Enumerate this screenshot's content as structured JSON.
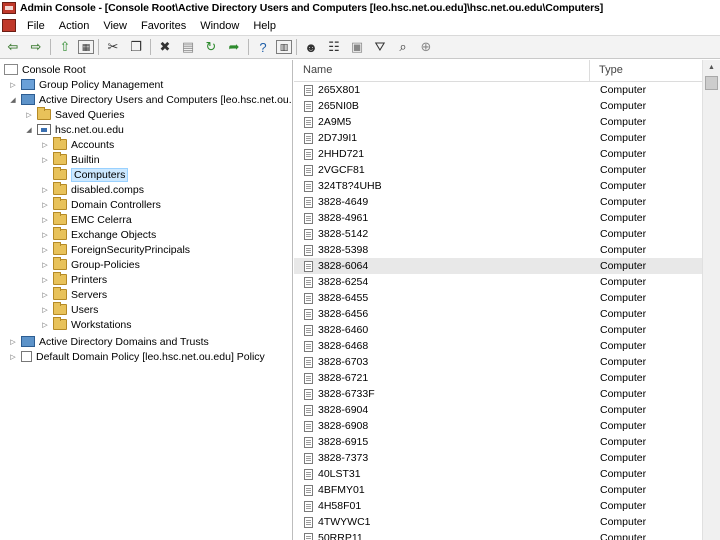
{
  "window": {
    "title": "Admin Console - [Console Root\\Active Directory Users and Computers [leo.hsc.net.ou.edu]\\hsc.net.ou.edu\\Computers]"
  },
  "menu": {
    "items": [
      "File",
      "Action",
      "View",
      "Favorites",
      "Window",
      "Help"
    ]
  },
  "toolbar": {
    "icons": [
      "back-arrow-icon",
      "forward-arrow-icon",
      "up-folder-icon",
      "show-tree-icon",
      "cut-icon",
      "copy-icon",
      "delete-icon",
      "properties-icon",
      "refresh-icon",
      "export-list-icon",
      "help-icon",
      "console-tree-icon",
      "new-user-icon",
      "new-group-icon",
      "new-ou-icon",
      "filter-icon",
      "find-icon",
      "add-to-group-icon"
    ]
  },
  "tree": {
    "items": [
      {
        "label": "Console Root",
        "depth": 0,
        "icon": "console-icon",
        "expander": ""
      },
      {
        "label": "Group Policy Management",
        "depth": 1,
        "icon": "group-policy-icon",
        "expander": "collapsed"
      },
      {
        "label": "Active Directory Users and Computers [leo.hsc.net.ou.edu]",
        "depth": 1,
        "icon": "ad-users-icon",
        "expander": "expanded"
      },
      {
        "label": "Saved Queries",
        "depth": 2,
        "icon": "folder-icon",
        "expander": "collapsed"
      },
      {
        "label": "hsc.net.ou.edu",
        "depth": 2,
        "icon": "domain-icon",
        "expander": "expanded"
      },
      {
        "label": "Accounts",
        "depth": 3,
        "icon": "folder-icon",
        "expander": "collapsed"
      },
      {
        "label": "Builtin",
        "depth": 3,
        "icon": "folder-icon",
        "expander": "collapsed"
      },
      {
        "label": "Computers",
        "depth": 3,
        "icon": "folder-icon",
        "expander": "",
        "selected": true
      },
      {
        "label": "disabled.comps",
        "depth": 3,
        "icon": "folder-icon",
        "expander": "collapsed"
      },
      {
        "label": "Domain Controllers",
        "depth": 3,
        "icon": "folder-icon",
        "expander": "collapsed"
      },
      {
        "label": "EMC Celerra",
        "depth": 3,
        "icon": "folder-icon",
        "expander": "collapsed"
      },
      {
        "label": "Exchange Objects",
        "depth": 3,
        "icon": "folder-icon",
        "expander": "collapsed"
      },
      {
        "label": "ForeignSecurityPrincipals",
        "depth": 3,
        "icon": "folder-icon",
        "expander": "collapsed"
      },
      {
        "label": "Group-Policies",
        "depth": 3,
        "icon": "folder-icon",
        "expander": "collapsed"
      },
      {
        "label": "Printers",
        "depth": 3,
        "icon": "folder-icon",
        "expander": "collapsed"
      },
      {
        "label": "Servers",
        "depth": 3,
        "icon": "folder-icon",
        "expander": "collapsed"
      },
      {
        "label": "Users",
        "depth": 3,
        "icon": "folder-icon",
        "expander": "collapsed"
      },
      {
        "label": "Workstations",
        "depth": 3,
        "icon": "folder-icon",
        "expander": "collapsed"
      },
      {
        "label": "Active Directory Domains and Trusts",
        "depth": 1,
        "icon": "ad-domains-icon",
        "expander": "collapsed"
      },
      {
        "label": "Default Domain Policy [leo.hsc.net.ou.edu] Policy",
        "depth": 1,
        "icon": "policy-doc-icon",
        "expander": "collapsed"
      }
    ]
  },
  "list": {
    "columns": [
      "Name",
      "Type"
    ],
    "rows": [
      {
        "name": "265X801",
        "type": "Computer"
      },
      {
        "name": "265NI0B",
        "type": "Computer"
      },
      {
        "name": "2A9M5",
        "type": "Computer"
      },
      {
        "name": "2D7J9I1",
        "type": "Computer"
      },
      {
        "name": "2HHD721",
        "type": "Computer"
      },
      {
        "name": "2VGCF81",
        "type": "Computer"
      },
      {
        "name": "324T8?4UHB",
        "type": "Computer"
      },
      {
        "name": "3828-4649",
        "type": "Computer"
      },
      {
        "name": "3828-4961",
        "type": "Computer"
      },
      {
        "name": "3828-5142",
        "type": "Computer"
      },
      {
        "name": "3828-5398",
        "type": "Computer"
      },
      {
        "name": "3828-6064",
        "type": "Computer",
        "highlight": true
      },
      {
        "name": "3828-6254",
        "type": "Computer"
      },
      {
        "name": "3828-6455",
        "type": "Computer"
      },
      {
        "name": "3828-6456",
        "type": "Computer"
      },
      {
        "name": "3828-6460",
        "type": "Computer"
      },
      {
        "name": "3828-6468",
        "type": "Computer"
      },
      {
        "name": "3828-6703",
        "type": "Computer"
      },
      {
        "name": "3828-6721",
        "type": "Computer"
      },
      {
        "name": "3828-6733F",
        "type": "Computer"
      },
      {
        "name": "3828-6904",
        "type": "Computer"
      },
      {
        "name": "3828-6908",
        "type": "Computer"
      },
      {
        "name": "3828-6915",
        "type": "Computer"
      },
      {
        "name": "3828-7373",
        "type": "Computer"
      },
      {
        "name": "40LST31",
        "type": "Computer"
      },
      {
        "name": "4BFMY01",
        "type": "Computer"
      },
      {
        "name": "4H58F01",
        "type": "Computer"
      },
      {
        "name": "4TWYWC1",
        "type": "Computer"
      },
      {
        "name": "50RRP11",
        "type": "Computer"
      }
    ]
  }
}
